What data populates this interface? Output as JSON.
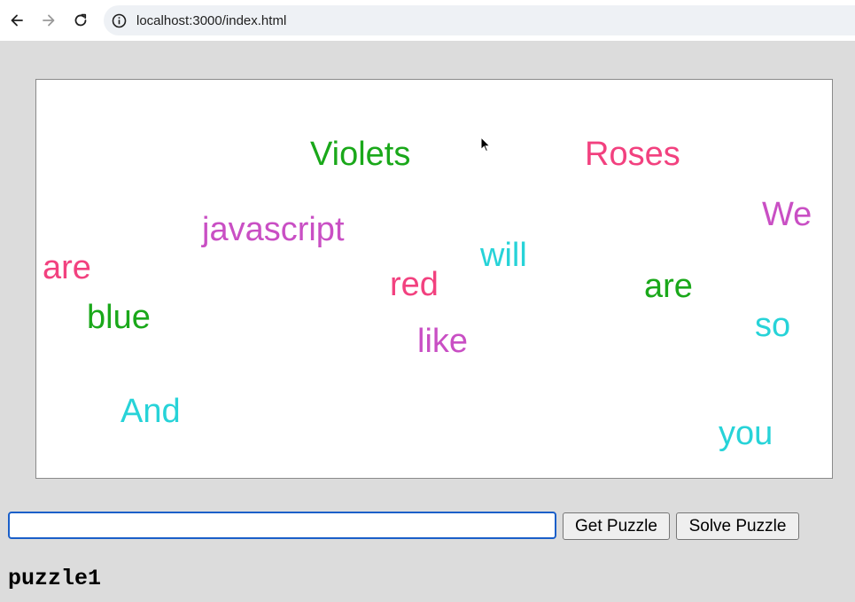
{
  "browser": {
    "url": "localhost:3000/index.html",
    "icons": [
      "back-arrow-icon",
      "forward-arrow-icon",
      "reload-icon",
      "site-info-icon"
    ]
  },
  "canvas": {
    "words": [
      {
        "text": "Violets",
        "color": "#1aa81a"
      },
      {
        "text": "Roses",
        "color": "#f2417f"
      },
      {
        "text": "We",
        "color": "#c94fc4"
      },
      {
        "text": "javascript",
        "color": "#c94fc4"
      },
      {
        "text": "are",
        "color": "#f2417f"
      },
      {
        "text": "will",
        "color": "#27d3d8"
      },
      {
        "text": "red",
        "color": "#f2417f"
      },
      {
        "text": "are",
        "color": "#1aa81a"
      },
      {
        "text": "blue",
        "color": "#1aa81a"
      },
      {
        "text": "so",
        "color": "#27d3d8"
      },
      {
        "text": "like",
        "color": "#c94fc4"
      },
      {
        "text": "And",
        "color": "#27d3d8"
      },
      {
        "text": "you",
        "color": "#27d3d8"
      }
    ]
  },
  "controls": {
    "answer_value": "",
    "get_label": "Get Puzzle",
    "solve_label": "Solve Puzzle"
  },
  "puzzle": {
    "name": "puzzle1"
  }
}
